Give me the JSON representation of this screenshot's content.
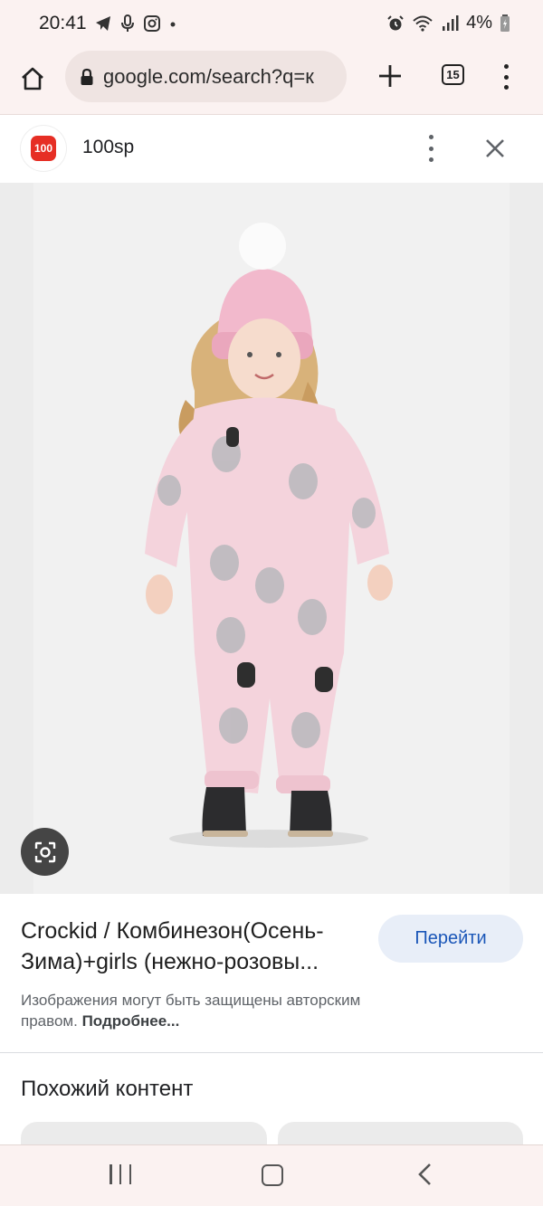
{
  "status_bar": {
    "time": "20:41",
    "left_icons": [
      "telegram-icon",
      "microphone-icon",
      "instagram-icon",
      "dot-icon"
    ],
    "right_icons": [
      "alarm-icon",
      "wifi-icon",
      "signal-icon"
    ],
    "battery_text": "4%"
  },
  "browser": {
    "url": "google.com/search?q=к",
    "tab_count": "15"
  },
  "source": {
    "logo_text": "100",
    "name": "100sp"
  },
  "result": {
    "title": "Crockid / Комбинезон(Осень-Зима)+girls (нежно-розовы...",
    "go_button": "Перейти",
    "copyright_text": "Изображения могут быть защищены авторским правом.",
    "more_link": "Подробнее..."
  },
  "similar": {
    "heading": "Похожий контент"
  },
  "colors": {
    "chrome_background": "#fbf2f1",
    "omnibox": "#efe4e2",
    "go_button_bg": "#e8eef8",
    "go_button_text": "#1a56b8",
    "logo_red": "#e62e24",
    "suit_pink": "#f4d3dc",
    "hat_pink": "#f2b9cc"
  }
}
